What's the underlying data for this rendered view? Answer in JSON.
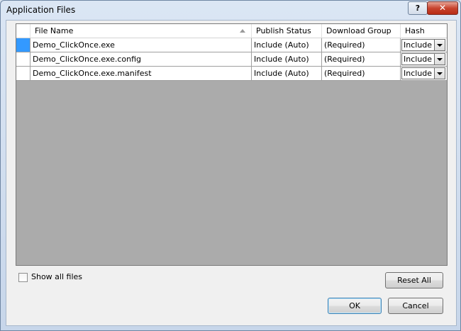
{
  "window": {
    "title": "Application Files"
  },
  "titlebar": {
    "help_glyph": "?",
    "close_glyph": "✕"
  },
  "grid": {
    "columns": [
      "File Name",
      "Publish Status",
      "Download Group",
      "Hash"
    ],
    "sort_column": "File Name",
    "rows": [
      {
        "file_name": "Demo_ClickOnce.exe",
        "publish_status": "Include (Auto)",
        "download_group": "(Required)",
        "hash": "Include",
        "selected": true
      },
      {
        "file_name": "Demo_ClickOnce.exe.config",
        "publish_status": "Include (Auto)",
        "download_group": "(Required)",
        "hash": "Include",
        "selected": false
      },
      {
        "file_name": "Demo_ClickOnce.exe.manifest",
        "publish_status": "Include (Auto)",
        "download_group": "(Required)",
        "hash": "Include",
        "selected": false
      }
    ]
  },
  "options": {
    "show_all_files_label": "Show all files",
    "show_all_files_checked": false
  },
  "buttons": {
    "reset_all": "Reset All",
    "ok": "OK",
    "cancel": "Cancel"
  },
  "colors": {
    "selection": "#3399ff",
    "grid_background": "#ababab"
  }
}
